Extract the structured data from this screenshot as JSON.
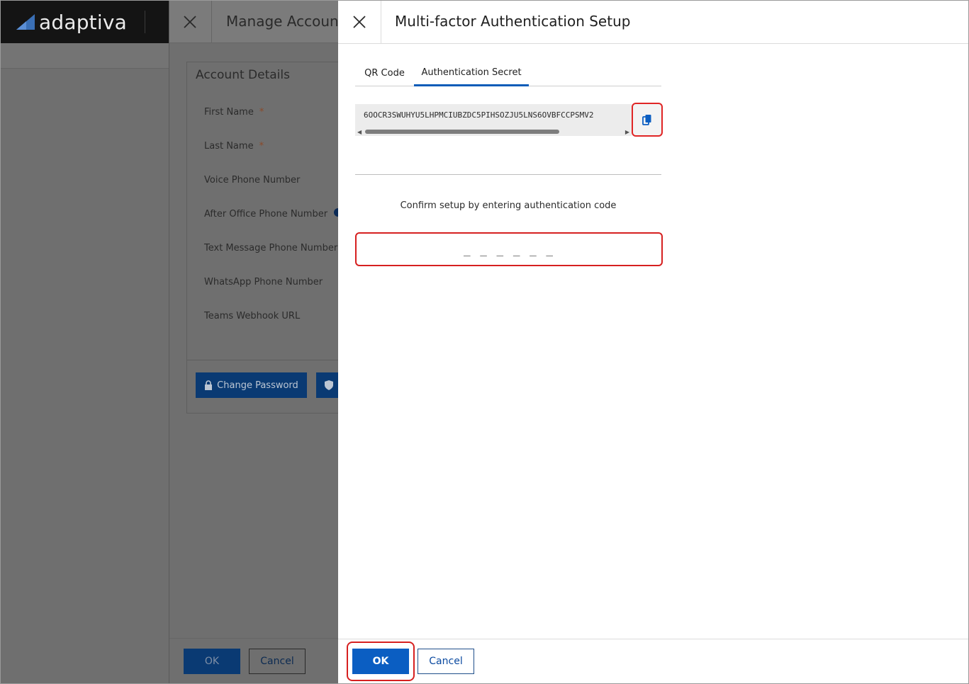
{
  "app": {
    "logo_text": "adaptiva"
  },
  "manage_account": {
    "title": "Manage Account",
    "section_title": "Account Details",
    "fields": [
      {
        "label": "First Name",
        "required": "*"
      },
      {
        "label": "Last Name",
        "required": "*"
      },
      {
        "label": "Voice Phone Number"
      },
      {
        "label": "After Office Phone Number"
      },
      {
        "label": "Text Message Phone Number"
      },
      {
        "label": "WhatsApp Phone Number"
      },
      {
        "label": "Teams Webhook URL"
      }
    ],
    "change_password_label": "Change Password",
    "ok_label": "OK",
    "cancel_label": "Cancel"
  },
  "mfa_dialog": {
    "title": "Multi-factor Authentication Setup",
    "tabs": [
      {
        "label": "QR Code",
        "active": false
      },
      {
        "label": "Authentication Secret",
        "active": true
      }
    ],
    "secret": "6OOCR3SWUHYU5LHPMCIUBZDC5PIHSOZJU5LNS6OVBFCCPSMV2",
    "confirm_text": "Confirm setup by entering authentication code",
    "code_placeholder": "_ _ _ _ _ _",
    "ok_label": "OK",
    "cancel_label": "Cancel"
  },
  "colors": {
    "accent": "#0b5ec2",
    "highlight": "#d62020",
    "topbar": "#141414",
    "overlay": "#6f6f6f"
  },
  "icons": [
    "adaptiva-logo-icon",
    "close-icon",
    "lock-icon",
    "shield-icon",
    "copy-icon",
    "info-icon"
  ]
}
